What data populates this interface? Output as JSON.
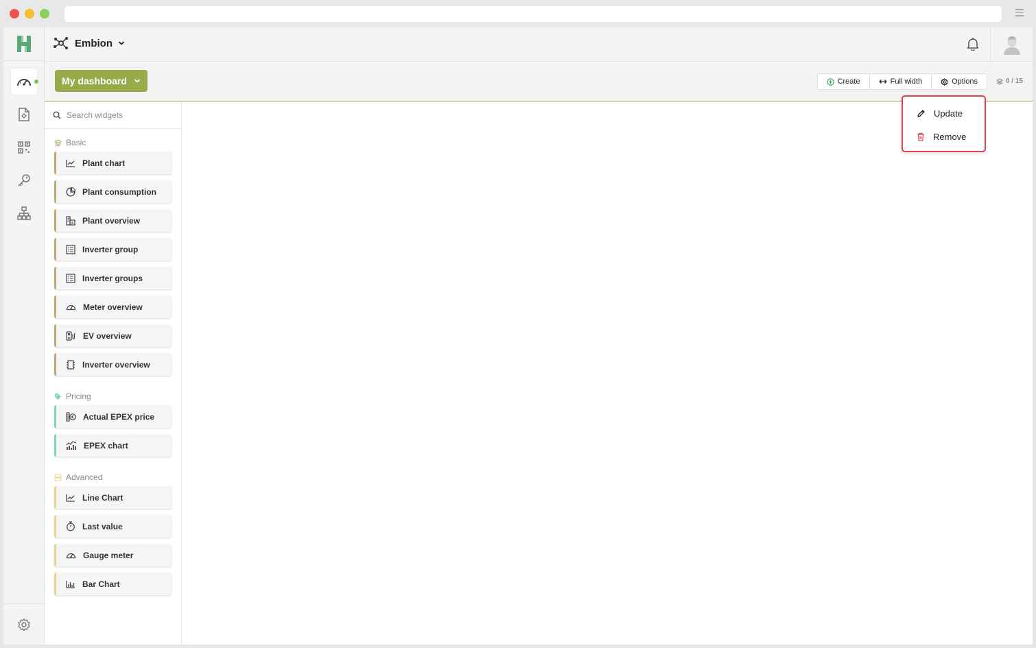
{
  "header": {
    "org_name": "Embion"
  },
  "dashboard": {
    "name": "My dashboard",
    "toolbar": {
      "create_label": "Create",
      "fullwidth_label": "Full width",
      "options_label": "Options"
    },
    "widget_count": "0 / 15"
  },
  "options_menu": {
    "update_label": "Update",
    "remove_label": "Remove"
  },
  "widgets": {
    "search_placeholder": "Search widgets",
    "sections": {
      "basic": {
        "label": "Basic",
        "items": [
          "Plant chart",
          "Plant consumption",
          "Plant overview",
          "Inverter group",
          "Inverter groups",
          "Meter overview",
          "EV overview",
          "Inverter overview"
        ]
      },
      "pricing": {
        "label": "Pricing",
        "items": [
          "Actual EPEX price",
          "EPEX chart"
        ]
      },
      "advanced": {
        "label": "Advanced",
        "items": [
          "Line Chart",
          "Last value",
          "Gauge meter",
          "Bar Chart"
        ]
      }
    }
  },
  "colors": {
    "brand_green": "#98ab4a",
    "highlight_red": "#e0414c",
    "basic_accent": "#bfa977",
    "pricing_accent": "#7fd4c8",
    "advanced_accent": "#ead48c"
  },
  "icons": {
    "rail": [
      "dashboard-icon",
      "report-icon",
      "qr-grid-icon",
      "key-icon",
      "hierarchy-icon",
      "settings-icon"
    ],
    "widgets": [
      "line-chart-icon",
      "pie-chart-icon",
      "building-icon",
      "list-icon",
      "list-icon",
      "gauge-icon",
      "ev-charger-icon",
      "chip-icon",
      "coins-icon",
      "bar-line-icon",
      "line-chart-icon",
      "stopwatch-icon",
      "gauge-icon",
      "bar-chart-icon"
    ]
  }
}
